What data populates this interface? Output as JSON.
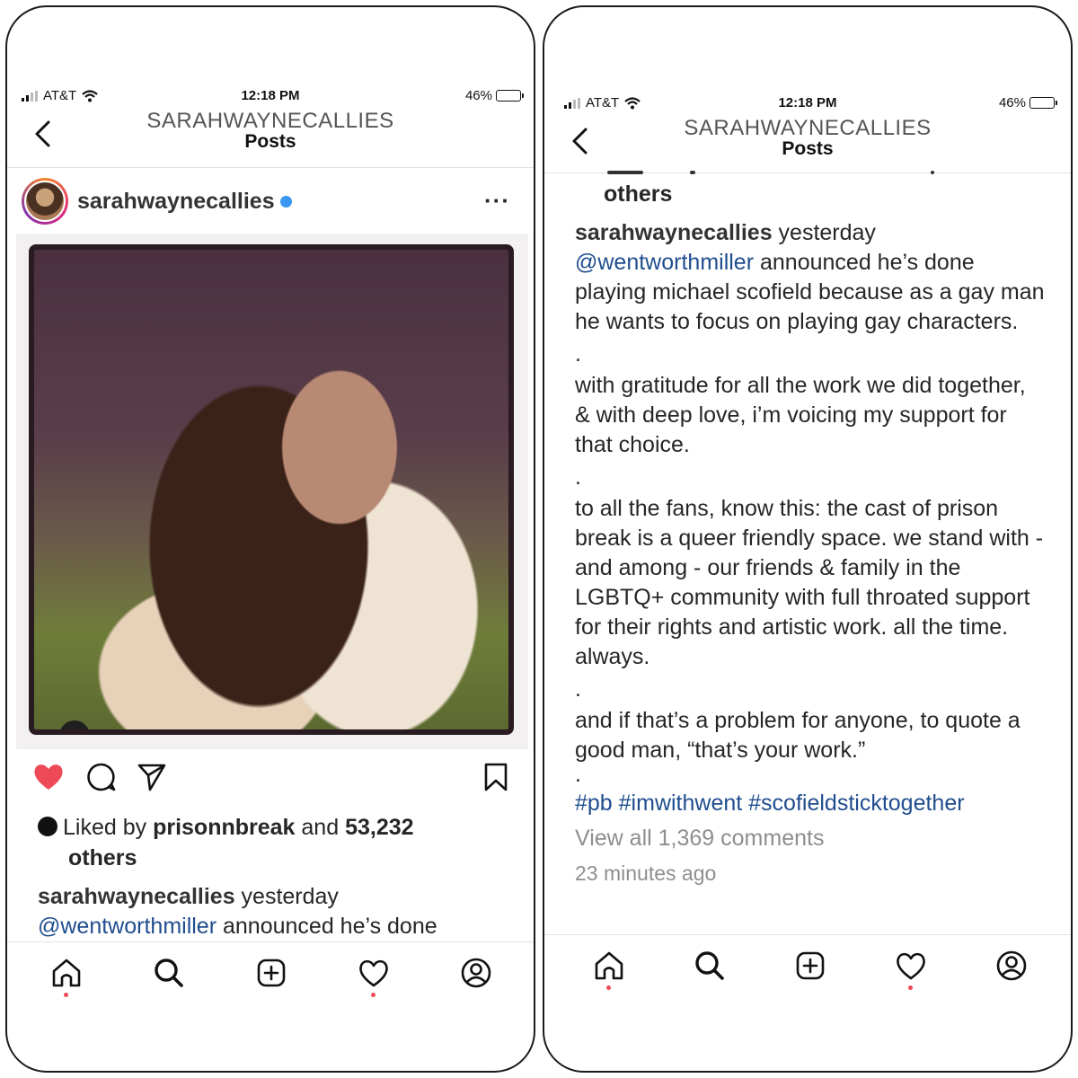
{
  "status": {
    "carrier": "AT&T",
    "time": "12:18 PM",
    "battery": "46%",
    "battery_level": 0.46
  },
  "header": {
    "account": "SARAHWAYNECALLIES",
    "section": "Posts"
  },
  "post": {
    "username": "sarahwaynecallies",
    "liked_by_prefix": "Liked by",
    "liked_by_user": "prisonnbreak",
    "liked_and": "and",
    "likes_count": "53,232",
    "likes_others": "others",
    "caption_time": "yesterday",
    "mention": "@wentworthmiller",
    "caption_p1_rest": "announced he’s done playing michael scofield because as a gay man he wants to focus on playing gay characters.",
    "caption_left_rest": "announced he’s done",
    "dot": ".",
    "caption_p2": "with gratitude for all the work we did together, & with deep love, i’m voicing my support for that choice.",
    "caption_p3": "to all the fans, know this: the cast of prison break is a queer friendly space.  we stand with - and among - our friends & family in the LGBTQ+ community with full throated support for their rights and artistic work.  all the time.  always.",
    "caption_p4": "and if that’s a problem for anyone, to quote a good man, “that’s your work.”",
    "hashtags": "#pb #imwithwent #scofieldsticktogether",
    "view_all_comments": "View all 1,369 comments",
    "posted_ago": "23 minutes ago"
  },
  "icons": {
    "back": "chevron-left-icon",
    "like": "heart-filled-icon",
    "comment": "comment-icon",
    "share": "send-icon",
    "save": "bookmark-icon",
    "more": "more-dots-icon",
    "tabs": [
      "home-icon",
      "search-icon",
      "add-post-icon",
      "activity-heart-icon",
      "profile-icon"
    ]
  },
  "colors": {
    "like_red": "#ed4956",
    "link_blue": "#1f4d8e",
    "muted_gray": "#8e8e8e",
    "verified_blue": "#3897f0"
  }
}
